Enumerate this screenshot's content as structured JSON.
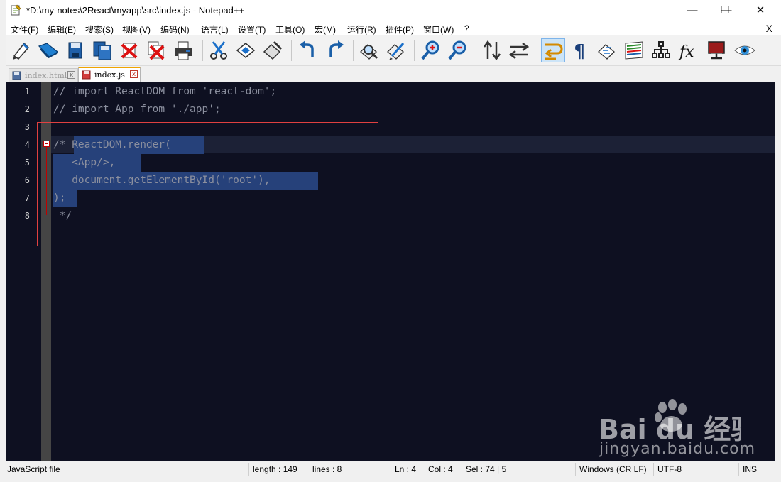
{
  "window": {
    "title": "*D:\\my-notes\\2React\\myapp\\src\\index.js - Notepad++",
    "minimize": "—",
    "maximize": "☐",
    "close": "✕"
  },
  "menu": {
    "items": [
      "文件(F)",
      "编辑(E)",
      "搜索(S)",
      "视图(V)",
      "编码(N)",
      "语言(L)",
      "设置(T)",
      "工具(O)",
      "宏(M)",
      "运行(R)",
      "插件(P)",
      "窗口(W)",
      "?"
    ],
    "close_doc": "X"
  },
  "toolbar": {
    "icons": [
      "new-file-icon",
      "open-file-icon",
      "save-icon",
      "save-all-icon",
      "close-icon",
      "close-all-icon",
      "print-icon",
      "cut-icon",
      "copy-icon",
      "paste-icon",
      "undo-icon",
      "redo-icon",
      "find-icon",
      "replace-icon",
      "zoom-in-icon",
      "zoom-out-icon",
      "sync-vertical-icon",
      "sync-horizontal-icon",
      "word-wrap-icon",
      "show-all-chars-icon",
      "indent-guide-icon",
      "doc-map-icon",
      "function-list-icon",
      "fx-icon",
      "monitor-icon",
      "eye-icon"
    ]
  },
  "tabs": [
    {
      "label": "index.html",
      "close": "x",
      "active": false
    },
    {
      "label": "index.js",
      "close": "x",
      "active": true
    }
  ],
  "editor": {
    "line_numbers": [
      "1",
      "2",
      "3",
      "4",
      "5",
      "6",
      "7",
      "8"
    ],
    "lines": [
      "// import ReactDOM from 'react-dom';",
      "// import App from './app';",
      "",
      "/* ReactDOM.render(",
      "   <App/>,",
      "   document.getElementById('root'),",
      ");",
      " */"
    ],
    "current_line": 4
  },
  "status": {
    "file_type": "JavaScript file",
    "length": "length : 149",
    "lines": "lines : 8",
    "ln": "Ln : 4",
    "col": "Col : 4",
    "sel": "Sel : 74 | 5",
    "eol": "Windows (CR LF)",
    "encoding": "UTF-8",
    "mode": "INS"
  },
  "watermark": {
    "logo": "Bai du 经验",
    "url": "jingyan.baidu.com"
  },
  "colors": {
    "editor_bg": "#0e1021",
    "selection": "#26417a",
    "comment": "#8b8f9e",
    "annotation": "#e04040",
    "active_tab_accent": "#f0a400"
  }
}
